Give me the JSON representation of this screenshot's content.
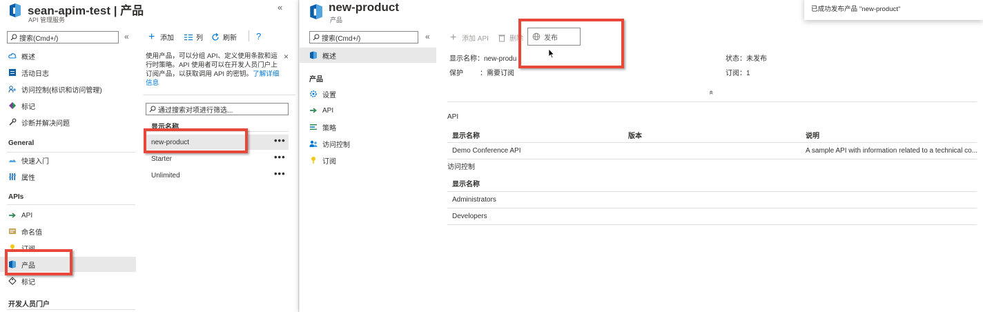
{
  "app": {
    "title": "sean-apim-test | 产品",
    "subtitle": "API 管理服务",
    "collapse_glyph": "«"
  },
  "sidebar": {
    "search_placeholder": "搜索(Cmd+/)",
    "collapse_glyph": "«",
    "items_top": [
      {
        "label": "概述",
        "icon": "cloud-icon"
      },
      {
        "label": "活动日志",
        "icon": "activity-log-icon"
      },
      {
        "label": "访问控制(标识和访问管理)",
        "icon": "people-icon"
      },
      {
        "label": "标记",
        "icon": "tag-icon"
      },
      {
        "label": "诊断并解决问题",
        "icon": "wrench-icon"
      }
    ],
    "section_general": "General",
    "items_general": [
      {
        "label": "快速入门",
        "icon": "quickstart-icon"
      },
      {
        "label": "属性",
        "icon": "properties-icon"
      }
    ],
    "section_apis": "APIs",
    "items_apis": [
      {
        "label": "API",
        "icon": "api-icon"
      },
      {
        "label": "命名值",
        "icon": "named-values-icon"
      },
      {
        "label": "订阅",
        "icon": "key-icon"
      },
      {
        "label": "产品",
        "icon": "product-icon",
        "selected": true
      },
      {
        "label": "标记",
        "icon": "tag-outline-icon"
      }
    ],
    "section_devportal": "开发人员门户"
  },
  "products": {
    "toolbar": {
      "add": "添加",
      "columns": "列",
      "refresh": "刷新",
      "help": "?"
    },
    "info_text": "使用产品，可以分组 API、定义使用条款和运行时策略。API 使用者可以在开发人员门户上订阅产品，以获取调用 API 的密钥。",
    "info_link": "了解详细信息",
    "info_close": "×",
    "filter_placeholder": "通过搜索对项进行筛选...",
    "column_header": "显示名称",
    "rows": [
      {
        "name": "new-product",
        "selected": true
      },
      {
        "name": "Starter"
      },
      {
        "name": "Unlimited"
      }
    ],
    "row_menu": "•••"
  },
  "detail": {
    "title": "new-product",
    "subtitle": "产品",
    "search_placeholder": "搜索(Cmd+/)",
    "collapse_glyph": "«",
    "nav_overview": "概述",
    "nav_section": "产品",
    "nav_items": [
      {
        "label": "设置",
        "icon": "settings-icon"
      },
      {
        "label": "API",
        "icon": "api-icon"
      },
      {
        "label": "策略",
        "icon": "policy-icon"
      },
      {
        "label": "访问控制",
        "icon": "people-icon"
      },
      {
        "label": "订阅",
        "icon": "key-icon"
      }
    ],
    "toolbar": {
      "add_api": "添加 API",
      "delete": "删除",
      "publish": "发布"
    },
    "essentials": {
      "display_name_label": "显示名称",
      "display_name_value": "new-produ",
      "protection_label": "保护",
      "protection_value": "需要订阅",
      "state_label": "状态",
      "state_value": "未发布",
      "subscriptions_label": "订阅",
      "subscriptions_value": "1",
      "collapse_glyph": "«"
    },
    "api_section": {
      "title": "API",
      "columns": [
        "显示名称",
        "版本",
        "说明"
      ],
      "rows": [
        [
          "Demo Conference API",
          "",
          "A sample API with information related to a technical co..."
        ]
      ]
    },
    "access_section": {
      "title": "访问控制",
      "column": "显示名称",
      "rows": [
        "Administrators",
        "Developers"
      ]
    }
  },
  "notification": {
    "text": "已成功发布产品 \"new-product\""
  },
  "colors": {
    "highlight_box": "#e8473a",
    "link": "#0078d4",
    "selected_bg": "#e8e8e8"
  }
}
